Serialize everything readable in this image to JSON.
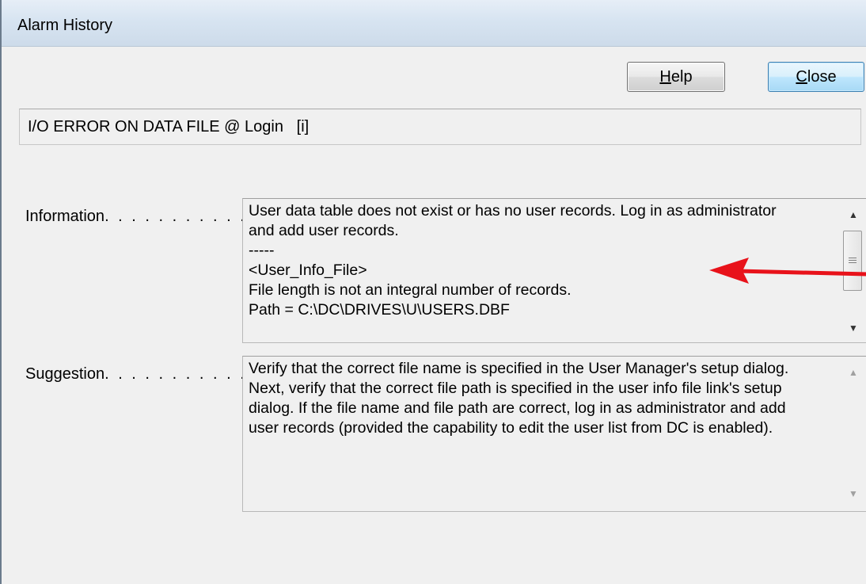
{
  "window": {
    "title": "Alarm History"
  },
  "buttons": {
    "help": {
      "prefix": "",
      "mnemonic": "H",
      "rest": "elp"
    },
    "close": {
      "prefix": "",
      "mnemonic": "C",
      "rest": "lose"
    }
  },
  "error_message": "I/O ERROR ON DATA FILE @ Login   [i]",
  "information": {
    "label": "Information",
    "dots": ". . . . . . . . . . . . . .",
    "lines": [
      "User data table does not exist or has no user records. Log in as administrator",
      "and add user records.",
      "-----",
      "<User_Info_File>",
      "File length is not an integral number of records.",
      "Path = C:\\DC\\DRIVES\\U\\USERS.DBF"
    ]
  },
  "suggestion": {
    "label": "Suggestion",
    "dots": ". . . . . . . . . . . . . .",
    "lines": [
      "Verify that the correct file name is specified in the User Manager's setup dialog.",
      "Next, verify that the correct file path is specified in the user info file link's setup",
      "dialog. If the file name and file path are correct, log in as administrator and add",
      "user records (provided the capability to edit the user list from DC is enabled)."
    ]
  },
  "icons": {
    "scroll_up": "scroll-up-arrow-icon",
    "scroll_down": "scroll-down-arrow-icon",
    "annotation": "red-arrow-icon"
  },
  "colors": {
    "annotation_arrow": "#e8121a",
    "default_button_border": "#3c7fb1",
    "title_bar": "#d7e4f1"
  }
}
